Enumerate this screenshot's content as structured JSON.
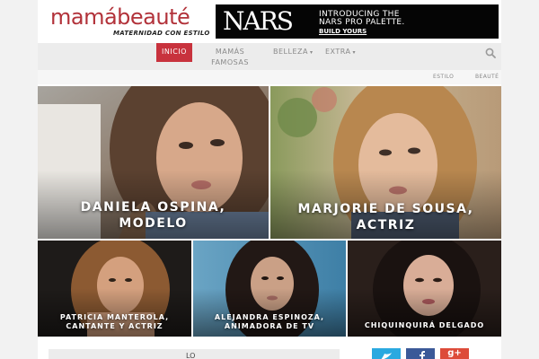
{
  "header": {
    "logo_mama": "mamá",
    "logo_beaute": "beauté",
    "logo_tagline": "MATERNIDAD CON ESTILO",
    "ad": {
      "brand": "NARS",
      "line1": "INTRODUCING THE",
      "line2": "NARS PRO PALETTE.",
      "cta": "BUILD YOURS"
    }
  },
  "nav": {
    "items": [
      {
        "label": "INICIO",
        "active": true
      },
      {
        "label": "MAMÁS",
        "label2": "FAMOSAS",
        "active": false
      },
      {
        "label": "BELLEZA",
        "active": false,
        "dropdown": true
      },
      {
        "label": "EXTRA",
        "active": false,
        "dropdown": true
      }
    ],
    "caret": "▾",
    "search_icon": "search-icon"
  },
  "subnav": {
    "items": [
      "ESTILO",
      "BEAUTÉ"
    ]
  },
  "featured": [
    {
      "line1": "DANIELA OSPINA,",
      "line2": "MODELO"
    },
    {
      "line1": "MARJORIE DE SOUSA,",
      "line2": "ACTRIZ"
    },
    {
      "line1": "PATRICIA MANTEROLA,",
      "line2": "CANTANTE Y ACTRIZ"
    },
    {
      "line1": "ALEJANDRA ESPINOZA,",
      "line2": "ANIMADORA DE TV"
    },
    {
      "line1": "CHIQUINQUIRÁ DELGADO",
      "line2": ""
    }
  ],
  "bottom": {
    "text": "LO"
  },
  "social": [
    {
      "icon": "twitter-icon",
      "color": "#2aa9e0"
    },
    {
      "icon": "facebook-icon",
      "color": "#3b5998"
    },
    {
      "icon": "google-plus-icon",
      "color": "#dd4b39",
      "label": "g+"
    }
  ],
  "colors": {
    "accent": "#c8323d",
    "brand": "#b2323a"
  }
}
